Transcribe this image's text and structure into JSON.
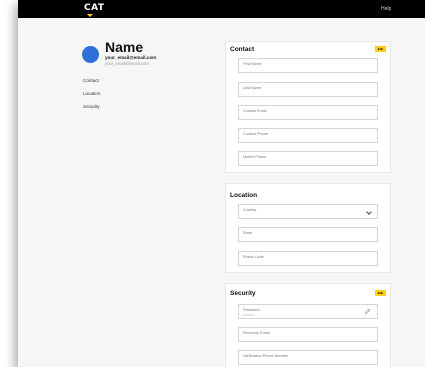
{
  "app": {
    "logo": "CAT",
    "help": "Help",
    "accent": "#ffcd11",
    "avatar_color": "#2f6fd8"
  },
  "profile": {
    "name": "Name",
    "email": "your_email@email.com",
    "email_secondary": "your_email@email.com"
  },
  "sidebar": {
    "items": [
      {
        "label": "Contact"
      },
      {
        "label": "Location"
      },
      {
        "label": "Security"
      }
    ]
  },
  "contact": {
    "title": "Contact",
    "edit_label": "Edit",
    "fields": [
      {
        "label": "First Name"
      },
      {
        "label": "Last Name"
      },
      {
        "label": "Contact Email"
      },
      {
        "label": "Contact Phone"
      },
      {
        "label": "Mobile Phone"
      }
    ]
  },
  "location": {
    "title": "Location",
    "fields": [
      {
        "label": "Country"
      },
      {
        "label": "State"
      },
      {
        "label": "Postal Code"
      }
    ]
  },
  "security": {
    "title": "Security",
    "edit_label": "Edit",
    "fields": [
      {
        "label": "Password",
        "value": "•••••••"
      },
      {
        "label": "Recovery Email"
      },
      {
        "label": "Verification Phone Number"
      }
    ]
  }
}
